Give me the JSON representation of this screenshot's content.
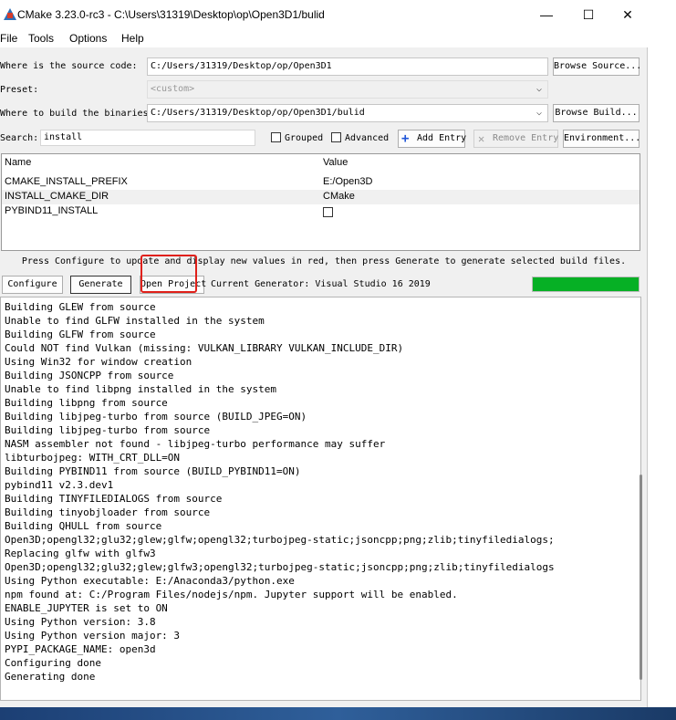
{
  "window": {
    "title": "CMake 3.23.0-rc3 - C:\\Users\\31319\\Desktop\\op\\Open3D1/bulid",
    "minimize": "—",
    "maximize": "☐",
    "close": "✕"
  },
  "menu": [
    "File",
    "Tools",
    "Options",
    "Help"
  ],
  "source": {
    "label": "Where is the source code:",
    "value": "C:/Users/31319/Desktop/op/Open3D1",
    "browse": "Browse Source..."
  },
  "preset": {
    "label": "Preset:",
    "value": "<custom>"
  },
  "build": {
    "label": "Where to build the binaries:",
    "value": "C:/Users/31319/Desktop/op/Open3D1/bulid",
    "browse": "Browse Build..."
  },
  "search": {
    "label": "Search:",
    "value": "install",
    "grouped": "Grouped",
    "advanced": "Advanced",
    "add_entry": "Add Entry",
    "remove_entry": "Remove Entry",
    "environment": "Environment..."
  },
  "table": {
    "headers": [
      "Name",
      "Value"
    ],
    "rows": [
      {
        "name": "CMAKE_INSTALL_PREFIX",
        "value": "E:/Open3D"
      },
      {
        "name": "INSTALL_CMAKE_DIR",
        "value": "CMake"
      },
      {
        "name": "PYBIND11_INSTALL",
        "value": ""
      }
    ]
  },
  "status": "Press Configure to update and display new values in red, then press Generate to generate selected build files.",
  "actions": {
    "configure": "Configure",
    "generate": "Generate",
    "open_project": "Open Project",
    "current_generator": "Current Generator: Visual Studio 16 2019"
  },
  "progress": 1.0,
  "colors": {
    "accent": "#06b025",
    "highlight": "#e0201a"
  },
  "output": [
    "Building GLEW from source",
    "Unable to find GLFW installed in the system",
    "Building GLFW from source",
    "Could NOT find Vulkan (missing: VULKAN_LIBRARY VULKAN_INCLUDE_DIR)",
    "Using Win32 for window creation",
    "Building JSONCPP from source",
    "Unable to find libpng installed in the system",
    "Building libpng from source",
    "Building libjpeg-turbo from source (BUILD_JPEG=ON)",
    "Building libjpeg-turbo from source",
    "NASM assembler not found - libjpeg-turbo performance may suffer",
    "libturbojpeg: WITH_CRT_DLL=ON",
    "Building PYBIND11 from source (BUILD_PYBIND11=ON)",
    "pybind11 v2.3.dev1",
    "Building TINYFILEDIALOGS from source",
    "Building tinyobjloader from source",
    "Building QHULL from source",
    "Open3D;opengl32;glu32;glew;glfw;opengl32;turbojpeg-static;jsoncpp;png;zlib;tinyfiledialogs;",
    "Replacing glfw with glfw3",
    "Open3D;opengl32;glu32;glew;glfw3;opengl32;turbojpeg-static;jsoncpp;png;zlib;tinyfiledialogs",
    "Using Python executable: E:/Anaconda3/python.exe",
    "npm found at: C:/Program Files/nodejs/npm. Jupyter support will be enabled.",
    "ENABLE_JUPYTER is set to ON",
    "Using Python version: 3.8",
    "Using Python version major: 3",
    "PYPI_PACKAGE_NAME: open3d",
    "Configuring done",
    "Generating done"
  ]
}
